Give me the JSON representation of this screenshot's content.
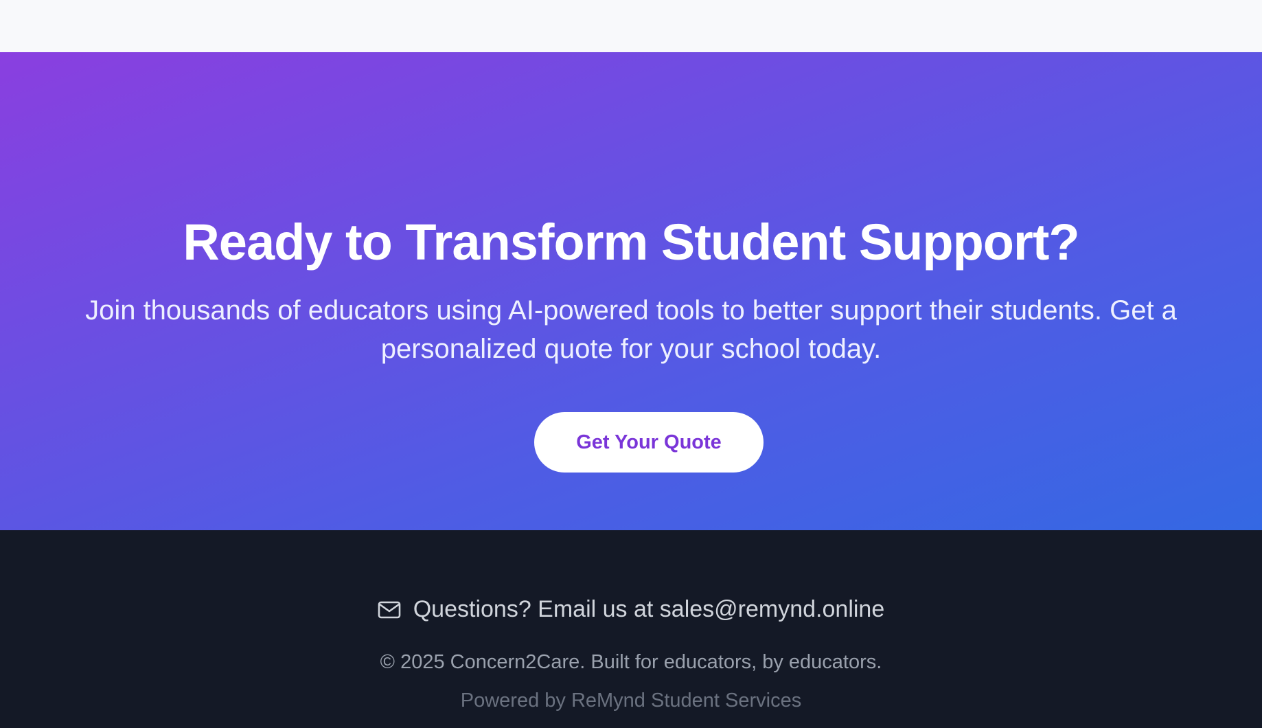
{
  "cta": {
    "title": "Ready to Transform Student Support?",
    "subtitle": "Join thousands of educators using AI-powered tools to better support their students. Get a personalized quote for your school today.",
    "button_label": "Get Your Quote",
    "gradient_colors": [
      "#8a3fe0",
      "#3468e3"
    ],
    "button_text_color": "#7a35d8"
  },
  "footer": {
    "contact_icon": "mail-icon",
    "contact_text": "Questions? Email us at sales@remynd.online",
    "copyright": "© 2025 Concern2Care. Built for educators, by educators.",
    "powered_by": "Powered by ReMynd Student Services",
    "background_color": "#141926"
  }
}
